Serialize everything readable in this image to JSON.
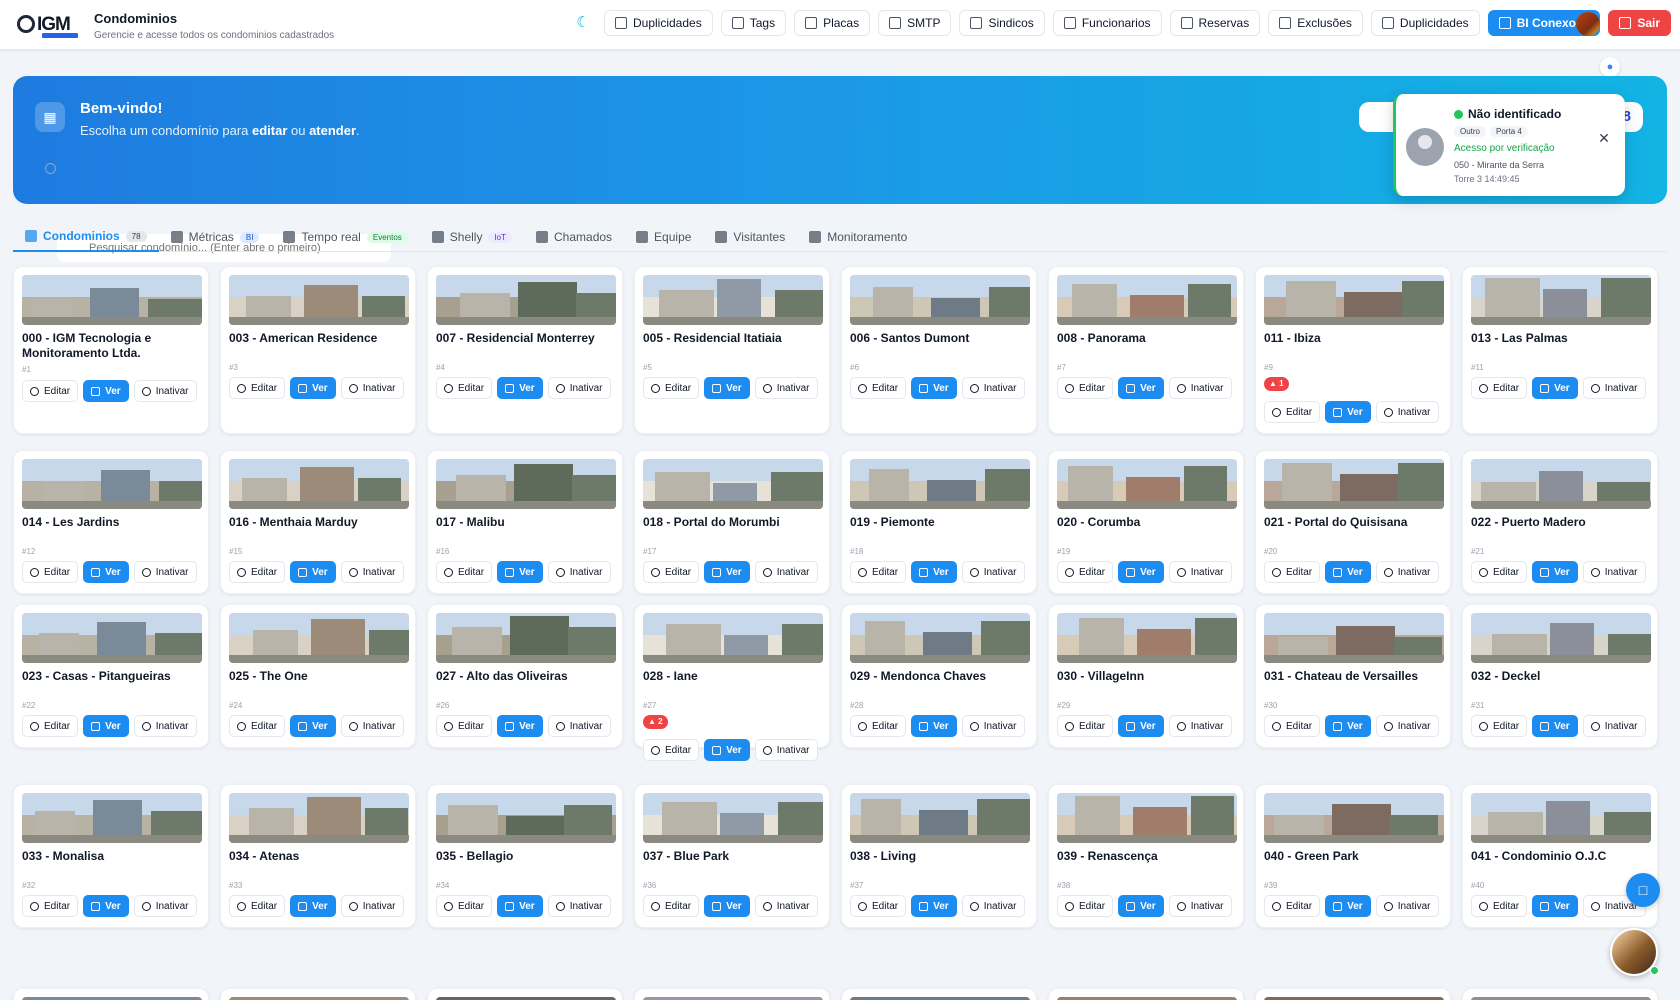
{
  "header": {
    "logo_text": "IGM",
    "title": "Condominios",
    "subtitle": "Gerencie e acesse todos os condominios cadastrados",
    "nav": [
      {
        "label": "Duplicidades",
        "icon": "grid-icon"
      },
      {
        "label": "Tags",
        "icon": "tag-icon"
      },
      {
        "label": "Placas",
        "icon": "car-icon"
      },
      {
        "label": "SMTP",
        "icon": "mail-icon"
      },
      {
        "label": "Sindicos",
        "icon": "user-cog-icon"
      },
      {
        "label": "Funcionarios",
        "icon": "users-icon"
      },
      {
        "label": "Reservas",
        "icon": "calendar-icon"
      },
      {
        "label": "Exclusões",
        "icon": "trash-icon"
      },
      {
        "label": "Duplicidades",
        "icon": "users-icon"
      },
      {
        "label": "BI Conexoes",
        "icon": "bar-chart-icon"
      },
      {
        "label": "Sair",
        "icon": "logout-icon"
      }
    ]
  },
  "hero": {
    "title": "Bem-vindo!",
    "subtitle_prefix": "Escolha um condomínio para ",
    "subtitle_edit": "editar",
    "subtitle_mid": " ou ",
    "subtitle_attend": "atender",
    "subtitle_suffix": ".",
    "search_placeholder": "Pesquisar condomínio... (Enter abre o primeiro)",
    "count": "78"
  },
  "popup": {
    "title": "Não identificado",
    "tags": [
      "Outro",
      "Porta 4"
    ],
    "status": "Acesso por verificação",
    "line1": "050 - Mirante da Serra",
    "line2": "Torre 3  14:49:45"
  },
  "tabs": [
    {
      "label": "Condominios",
      "badge": "78",
      "badge_style": "gray",
      "active": true
    },
    {
      "label": "Métricas",
      "badge": "BI",
      "badge_style": "blue",
      "active": false
    },
    {
      "label": "Tempo real",
      "badge": "Eventos",
      "badge_style": "green",
      "active": false
    },
    {
      "label": "Shelly",
      "badge": "IoT",
      "badge_style": "purple",
      "active": false
    },
    {
      "label": "Chamados",
      "badge": "",
      "badge_style": "",
      "active": false
    },
    {
      "label": "Equipe",
      "badge": "",
      "badge_style": "",
      "active": false
    },
    {
      "label": "Visitantes",
      "badge": "",
      "badge_style": "",
      "active": false
    },
    {
      "label": "Monitoramento",
      "badge": "",
      "badge_style": "",
      "active": false
    }
  ],
  "card_actions": {
    "edit": "Editar",
    "view": "Ver",
    "deactivate": "Inativar"
  },
  "condominios": [
    {
      "name": "000 - IGM Tecnologia e Monitoramento Ltda.",
      "id": "#1",
      "alert": ""
    },
    {
      "name": "003 - American Residence",
      "id": "#3",
      "alert": ""
    },
    {
      "name": "007 - Residencial Monterrey",
      "id": "#4",
      "alert": ""
    },
    {
      "name": "005 - Residencial Itatiaia",
      "id": "#5",
      "alert": ""
    },
    {
      "name": "006 - Santos Dumont",
      "id": "#6",
      "alert": ""
    },
    {
      "name": "008 - Panorama",
      "id": "#7",
      "alert": ""
    },
    {
      "name": "011 - Ibiza",
      "id": "#9",
      "alert": "1"
    },
    {
      "name": "013 - Las Palmas",
      "id": "#11",
      "alert": ""
    },
    {
      "name": "014 - Les Jardins",
      "id": "#12",
      "alert": ""
    },
    {
      "name": "016 - Menthaia Marduy",
      "id": "#15",
      "alert": ""
    },
    {
      "name": "017 - Malibu",
      "id": "#16",
      "alert": ""
    },
    {
      "name": "018 - Portal do Morumbi",
      "id": "#17",
      "alert": ""
    },
    {
      "name": "019 - Piemonte",
      "id": "#18",
      "alert": ""
    },
    {
      "name": "020 - Corumba",
      "id": "#19",
      "alert": ""
    },
    {
      "name": "021 - Portal do Quisisana",
      "id": "#20",
      "alert": ""
    },
    {
      "name": "022 - Puerto Madero",
      "id": "#21",
      "alert": ""
    },
    {
      "name": "023 - Casas - Pitangueiras",
      "id": "#22",
      "alert": ""
    },
    {
      "name": "025 - The One",
      "id": "#24",
      "alert": ""
    },
    {
      "name": "027 - Alto das Oliveiras",
      "id": "#26",
      "alert": ""
    },
    {
      "name": "028 - Iane",
      "id": "#27",
      "alert": "2"
    },
    {
      "name": "029 - Mendonca Chaves",
      "id": "#28",
      "alert": ""
    },
    {
      "name": "030 - VillageInn",
      "id": "#29",
      "alert": ""
    },
    {
      "name": "031 - Chateau de Versailles",
      "id": "#30",
      "alert": ""
    },
    {
      "name": "032 - Deckel",
      "id": "#31",
      "alert": ""
    },
    {
      "name": "033 - Monalisa",
      "id": "#32",
      "alert": ""
    },
    {
      "name": "034 - Atenas",
      "id": "#33",
      "alert": ""
    },
    {
      "name": "035 - Bellagio",
      "id": "#34",
      "alert": ""
    },
    {
      "name": "037 - Blue Park",
      "id": "#36",
      "alert": ""
    },
    {
      "name": "038 - Living",
      "id": "#37",
      "alert": ""
    },
    {
      "name": "039 - Renascença",
      "id": "#38",
      "alert": ""
    },
    {
      "name": "040 - Green Park",
      "id": "#39",
      "alert": ""
    },
    {
      "name": "041 - Condominio O.J.C",
      "id": "#40",
      "alert": ""
    }
  ],
  "colors": {
    "primary": "#1d8cf0",
    "danger": "#ef4444",
    "success": "#22c55e"
  }
}
